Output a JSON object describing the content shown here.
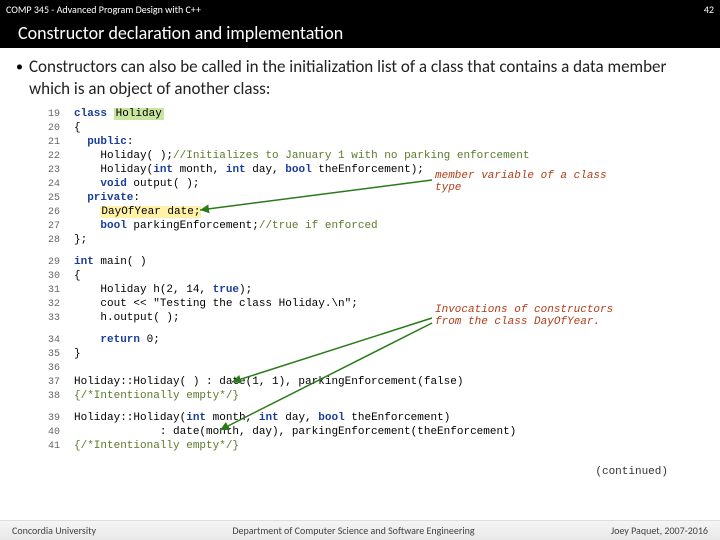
{
  "header": {
    "course": "COMP 345 - Advanced Program Design with C++",
    "slide_num": "42",
    "title": "Constructor declaration and implementation"
  },
  "bullet": "Constructors can also be called in the initialization list of a class that contains a data member which is an object of another class:",
  "code": {
    "l19a": "class ",
    "l19b": "Holiday",
    "l20": "{",
    "l21a": "public",
    "l21b": ":",
    "l22a": "Holiday( );",
    "l22b": "//Initializes to January 1 with no parking enforcement",
    "l23a": "Holiday(",
    "l23b": "int",
    "l23c": " month, ",
    "l23d": "int",
    "l23e": " day, ",
    "l23f": "bool",
    "l23g": " theEnforcement);",
    "l24a": "void",
    "l24b": " output( );",
    "l25a": "private",
    "l25b": ":",
    "l26": "DayOfYear date;",
    "l27a": "bool",
    "l27b": " parkingEnforcement;",
    "l27c": "//true if enforced",
    "l28": "};",
    "l29a": "int",
    "l29b": " main( )",
    "l30": "{",
    "l31a": "Holiday h(2, 14, ",
    "l31b": "true",
    "l31c": ");",
    "l32": "cout << \"Testing the class Holiday.\\n\";",
    "l33": "h.output( );",
    "l34a": "return",
    "l34b": " 0;",
    "l35": "}",
    "l37": "Holiday::Holiday( ) : date(1, 1), parkingEnforcement(false)",
    "l38": "{/*Intentionally empty*/}",
    "l39a": "Holiday::Holiday(",
    "l39b": "int",
    "l39c": " month, ",
    "l39d": "int",
    "l39e": " day, ",
    "l39f": "bool",
    "l39g": " theEnforcement)",
    "l40": "             : date(month, day), parkingEnforcement(theEnforcement)",
    "l41": "{/*Intentionally empty*/}"
  },
  "annotations": {
    "a1": "member variable of a class type",
    "a2": "Invocations of constructors from the class DayOfYear.",
    "continued": "(continued)"
  },
  "footer": {
    "left": "Concordia University",
    "center": "Department of Computer Science and Software Engineering",
    "right": "Joey Paquet, 2007-2016"
  }
}
